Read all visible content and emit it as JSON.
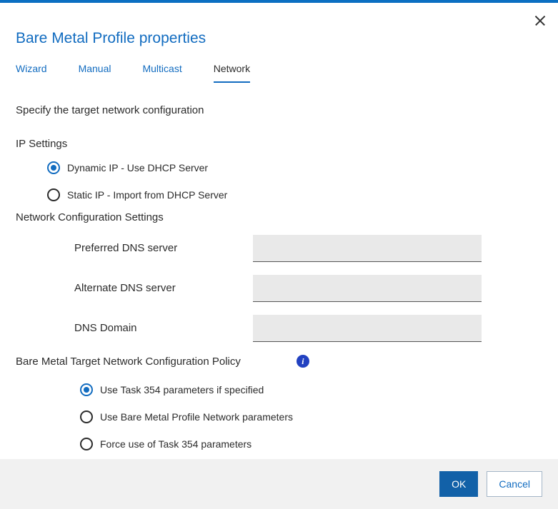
{
  "title": "Bare Metal Profile properties",
  "tabs": {
    "wizard": "Wizard",
    "manual": "Manual",
    "multicast": "Multicast",
    "network": "Network"
  },
  "intro": "Specify the target network configuration",
  "ip": {
    "heading": "IP Settings",
    "dynamic": "Dynamic IP - Use DHCP Server",
    "static": "Static IP - Import from DHCP Server"
  },
  "netconf": {
    "heading": "Network Configuration Settings",
    "preferred_dns_label": "Preferred DNS server",
    "preferred_dns_value": "",
    "alternate_dns_label": "Alternate DNS server",
    "alternate_dns_value": "",
    "dns_domain_label": "DNS Domain",
    "dns_domain_value": ""
  },
  "policy": {
    "heading": "Bare Metal Target Network Configuration Policy",
    "opt1": "Use Task 354 parameters if specified",
    "opt2": "Use Bare Metal Profile Network parameters",
    "opt3": "Force use of Task 354 parameters"
  },
  "footer": {
    "ok": "OK",
    "cancel": "Cancel"
  }
}
